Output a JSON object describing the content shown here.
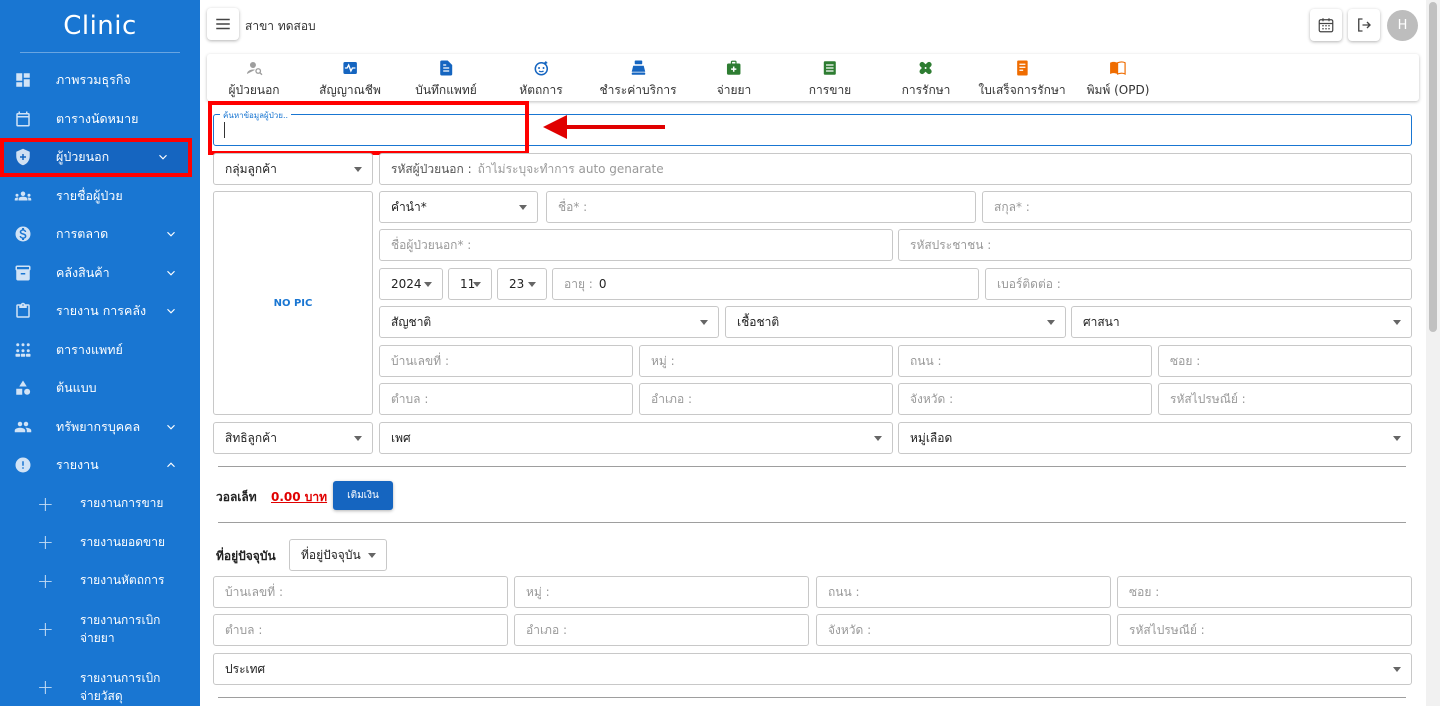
{
  "sidebar": {
    "brand": "Clinic",
    "items": [
      {
        "label": "ภาพรวมธุรกิจ",
        "icon": "dashboard-icon",
        "chevron": ""
      },
      {
        "label": "ตารางนัดหมาย",
        "icon": "calendar-icon",
        "chevron": ""
      },
      {
        "label": "ผู้ป่วยนอก",
        "icon": "shield-icon",
        "chevron": "down"
      },
      {
        "label": "รายชื่อผู้ป่วย",
        "icon": "group-icon",
        "chevron": ""
      },
      {
        "label": "การตลาด",
        "icon": "dollar-icon",
        "chevron": "down"
      },
      {
        "label": "คลังสินค้า",
        "icon": "archive-icon",
        "chevron": "down"
      },
      {
        "label": "รายงาน การคลัง",
        "icon": "clipboard-icon",
        "chevron": "down"
      },
      {
        "label": "ตารางแพทย์",
        "icon": "people-grid-icon",
        "chevron": ""
      },
      {
        "label": "ต้นแบบ",
        "icon": "shapes-icon",
        "chevron": ""
      },
      {
        "label": "ทรัพยากรบุคคล",
        "icon": "people-icon",
        "chevron": "down"
      },
      {
        "label": "รายงาน",
        "icon": "alert-icon",
        "chevron": "up"
      }
    ],
    "sub_items": [
      {
        "label": "รายงานการขาย"
      },
      {
        "label": "รายงานยอดขาย"
      },
      {
        "label": "รายงานหัตถการ"
      },
      {
        "label": "รายงานการเบิก",
        "label2": "จ่ายยา"
      },
      {
        "label": "รายงานการเบิก",
        "label2": "จ่ายวัสดุ"
      }
    ]
  },
  "header": {
    "branch": "สาขา ทดสอบ",
    "avatar": "H"
  },
  "tabs": [
    {
      "label": "ผู้ป่วยนอก",
      "icon": "person-search-icon",
      "color": "#9e9e9e"
    },
    {
      "label": "สัญญาณชีพ",
      "icon": "pulse-icon",
      "color": "#1565c0"
    },
    {
      "label": "บันทึกแพทย์",
      "icon": "document-icon",
      "color": "#1565c0"
    },
    {
      "label": "หัตถการ",
      "icon": "face-icon",
      "color": "#1565c0"
    },
    {
      "label": "ชำระค่าบริการ",
      "icon": "cashier-icon",
      "color": "#1565c0"
    },
    {
      "label": "จ่ายยา",
      "icon": "medkit-icon",
      "color": "#2e7d32"
    },
    {
      "label": "การขาย",
      "icon": "list-icon",
      "color": "#2e7d32"
    },
    {
      "label": "การรักษา",
      "icon": "bandage-icon",
      "color": "#2e7d32"
    },
    {
      "label": "ใบเสร็จการรักษา",
      "icon": "receipt-icon",
      "color": "#ef6c00"
    },
    {
      "label": "พิมพ์ (OPD)",
      "icon": "book-icon",
      "color": "#ef6c00"
    }
  ],
  "search": {
    "label": "ค้นหาข้อมูลผู้ป่วย.."
  },
  "form": {
    "customer_group": "กลุ่มลูกค้า",
    "patient_code_label": "รหัสผู้ป่วยนอก :",
    "patient_code_placeholder": "ถ้าไม่ระบุจะทำการ auto genarate",
    "no_pic": "NO PIC",
    "prefix": "คำนำ*",
    "first_name": "ชื่อ* :",
    "last_name": "สกุล* :",
    "opd_name": "ชื่อผู้ป่วยนอก* :",
    "citizen_id": "รหัสประชาชน :",
    "year": "2024",
    "month": "11",
    "day": "23",
    "age_label": "อายุ :",
    "age_value": "0",
    "phone": "เบอร์ติดต่อ :",
    "nationality": "สัญชาติ",
    "race": "เชื้อชาติ",
    "religion": "ศาสนา",
    "house_no": "บ้านเลขที่ :",
    "moo": "หมู่ :",
    "road": "ถนน :",
    "soi": "ซอย :",
    "subdistrict": "ตำบล :",
    "district": "อำเภอ :",
    "province": "จังหวัด :",
    "postcode": "รหัสไปรษณีย์ :",
    "rights": "สิทธิลูกค้า",
    "gender": "เพศ",
    "blood": "หมู่เลือด"
  },
  "wallet": {
    "label": "วอลเล็ท",
    "amount": "0.00 บาท",
    "topup": "เติมเงิน"
  },
  "address": {
    "label": "ที่อยู่ปัจจุบัน",
    "select": "ที่อยู่ปัจจุบัน",
    "house_no": "บ้านเลขที่ :",
    "moo": "หมู่ :",
    "road": "ถนน :",
    "soi": "ซอย :",
    "subdistrict": "ตำบล :",
    "district": "อำเภอ :",
    "province": "จังหวัด :",
    "postcode": "รหัสไปรษณีย์ :",
    "country": "ประเทศ"
  },
  "colors": {
    "sidebar": "#1976d2",
    "highlight": "#ff0000",
    "primary": "#1565c0"
  }
}
